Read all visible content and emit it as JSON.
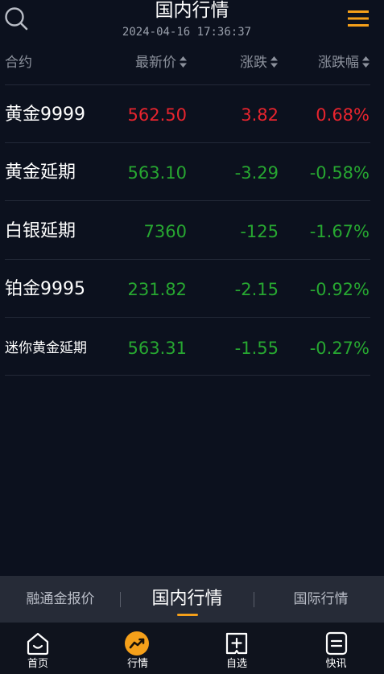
{
  "header": {
    "title": "国内行情",
    "timestamp": "2024-04-16 17:36:37",
    "search_icon": "search-icon",
    "menu_icon": "hamburger-menu-icon",
    "menu_color": "#f5a01a"
  },
  "columns": {
    "name": "合约",
    "price": "最新价",
    "change": "涨跌",
    "pct": "涨跌幅"
  },
  "rows": [
    {
      "name": "黄金9999",
      "price": "562.50",
      "change": "3.82",
      "pct": "0.68%",
      "trend": "up"
    },
    {
      "name": "黄金延期",
      "price": "563.10",
      "change": "-3.29",
      "pct": "-0.58%",
      "trend": "down"
    },
    {
      "name": "白银延期",
      "price": "7360",
      "change": "-125",
      "pct": "-1.67%",
      "trend": "down"
    },
    {
      "name": "铂金9995",
      "price": "231.82",
      "change": "-2.15",
      "pct": "-0.92%",
      "trend": "down"
    },
    {
      "name": "迷你黄金延期",
      "price": "563.31",
      "change": "-1.55",
      "pct": "-0.27%",
      "trend": "down"
    }
  ],
  "colors": {
    "up": "#e8242e",
    "down": "#27a731",
    "accent": "#f5a01a",
    "background": "#0c111e"
  },
  "market_tabs": [
    {
      "label": "融通金报价",
      "active": false
    },
    {
      "label": "国内行情",
      "active": true
    },
    {
      "label": "国际行情",
      "active": false
    }
  ],
  "bottom_nav": [
    {
      "label": "首页",
      "icon": "home-icon",
      "active": false
    },
    {
      "label": "行情",
      "icon": "trend-chart-icon",
      "active": true
    },
    {
      "label": "自选",
      "icon": "add-favorite-icon",
      "active": false
    },
    {
      "label": "快讯",
      "icon": "news-icon",
      "active": false
    }
  ]
}
